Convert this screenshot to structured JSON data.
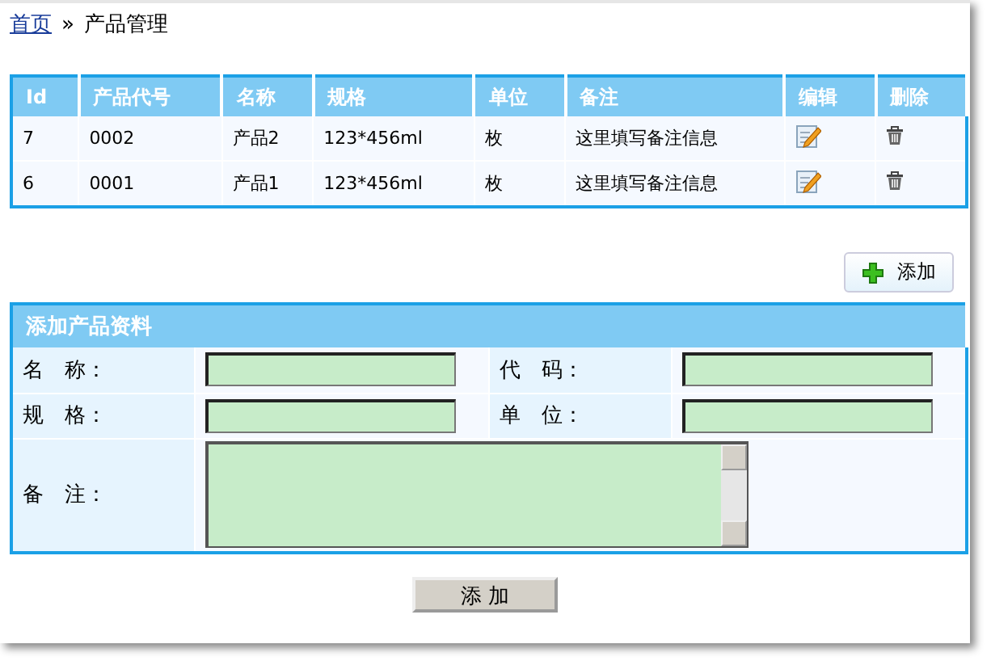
{
  "breadcrumb": {
    "home_link": "首页",
    "separator": "»",
    "current": "产品管理"
  },
  "table": {
    "columns": [
      "Id",
      "产品代号",
      "名称",
      "规格",
      "单位",
      "备注",
      "编辑",
      "删除"
    ],
    "rows": [
      {
        "id": "7",
        "code": "0002",
        "name": "产品2",
        "spec": "123*456ml",
        "unit": "枚",
        "note": "这里填写备注信息"
      },
      {
        "id": "6",
        "code": "0001",
        "name": "产品1",
        "spec": "123*456ml",
        "unit": "枚",
        "note": "这里填写备注信息"
      }
    ]
  },
  "add_button": "添加",
  "form": {
    "title": "添加产品资料",
    "fields": [
      {
        "label": "名　称：",
        "kind": "input"
      },
      {
        "label": "代　码：",
        "kind": "input"
      },
      {
        "label": "规　格：",
        "kind": "input"
      },
      {
        "label": "单　位：",
        "kind": "input"
      },
      {
        "label": "备　注：",
        "kind": "textarea"
      }
    ],
    "submit": "添 加"
  }
}
